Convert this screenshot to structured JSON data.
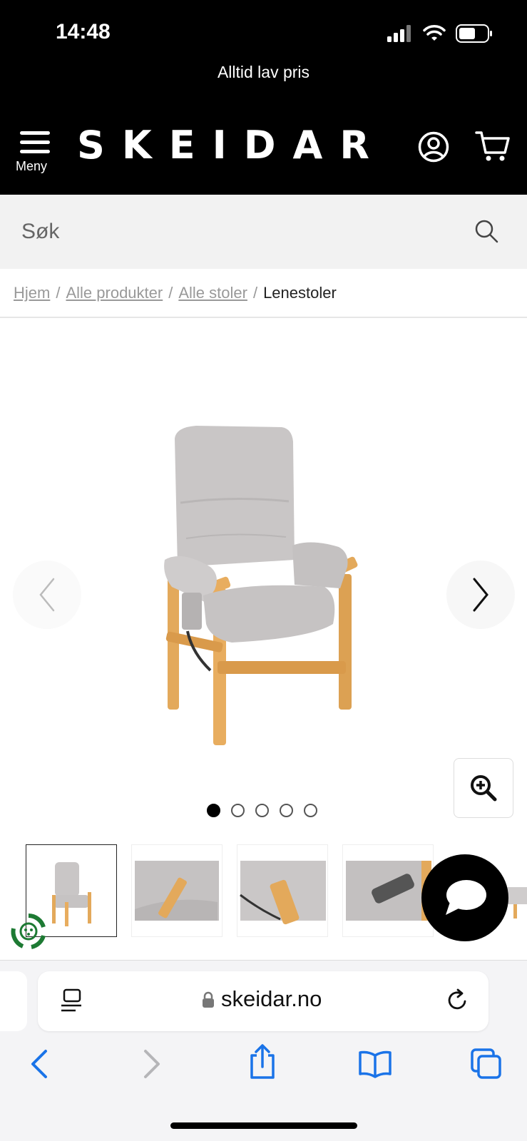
{
  "status_bar": {
    "time": "14:48"
  },
  "header": {
    "promo": "Alltid lav pris",
    "menu_label": "Meny",
    "logo": "SKEIDAR",
    "icons": {
      "account": "user-circle-icon",
      "cart": "shopping-cart-icon",
      "menu": "hamburger-icon"
    }
  },
  "search": {
    "placeholder": "Søk",
    "value": ""
  },
  "breadcrumb": [
    {
      "label": "Hjem"
    },
    {
      "label": "Alle produkter"
    },
    {
      "label": "Alle stoler"
    },
    {
      "label": "Lenestoler"
    }
  ],
  "carousel": {
    "slide_count": 5,
    "active_slide": 1
  },
  "browser": {
    "url": "skeidar.no"
  },
  "colors": {
    "header_bg": "#000000",
    "search_bg": "#f2f2f2",
    "link_gray": "#999999",
    "ios_blue": "#1a73e8",
    "eco_green": "#1d7a33",
    "fabric_gray": "#c9c6c6",
    "wood": "#e3a95b"
  }
}
